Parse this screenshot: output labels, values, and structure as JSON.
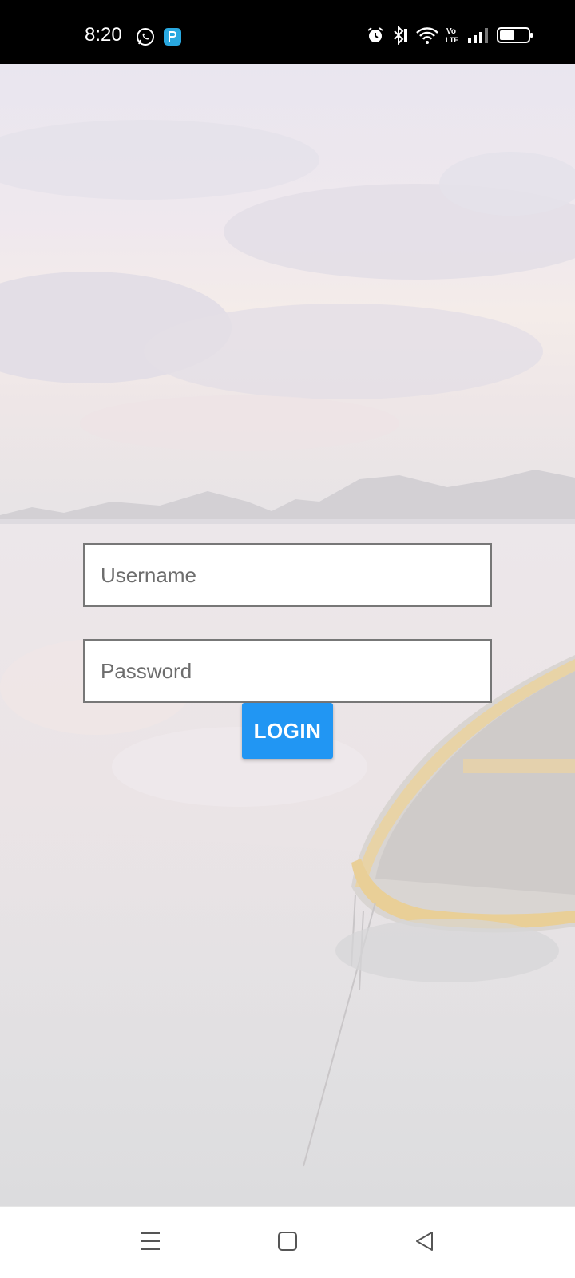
{
  "status_bar": {
    "time": "8:20",
    "left_icons": [
      "whatsapp-icon",
      "app-notification-icon"
    ],
    "right_icons": [
      "alarm-icon",
      "bluetooth-icon",
      "wifi-icon",
      "volte-icon",
      "signal-icon",
      "battery-icon"
    ],
    "volte_text": "Vo LTE"
  },
  "form": {
    "username_placeholder": "Username",
    "password_placeholder": "Password",
    "login_label": "LOGIN"
  },
  "colors": {
    "accent": "#2196F3",
    "status_bar_bg": "#000000",
    "nav_bar_bg": "#FFFFFF"
  },
  "nav_bar": {
    "icons": [
      "menu-icon",
      "home-square-icon",
      "back-triangle-icon"
    ]
  }
}
